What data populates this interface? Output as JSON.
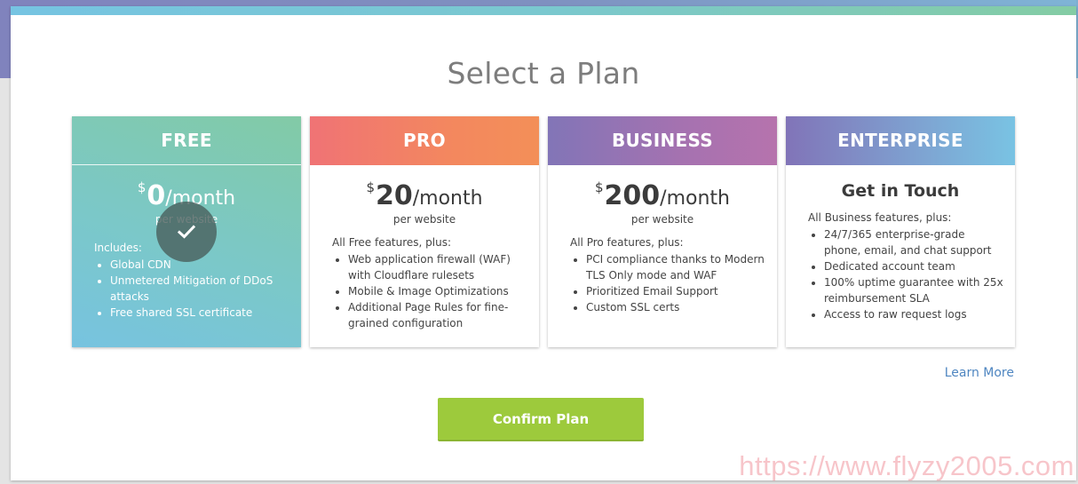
{
  "page": {
    "title": "Select a Plan",
    "learn_more": "Learn More",
    "confirm_label": "Confirm Plan",
    "watermark": "https://www.flyzy2005.com",
    "selected_plan": "FREE"
  },
  "colors": {
    "confirm": "#9dca3c",
    "link": "#4f86c1",
    "title": "#7d7d7d"
  },
  "plans": [
    {
      "name": "FREE",
      "currency": "$",
      "amount": "0",
      "period": "/month",
      "per": "per website",
      "intro": "Includes:",
      "features": [
        "Global CDN",
        "Unmetered Mitigation of DDoS attacks",
        "Free shared SSL certificate"
      ],
      "selected_icon": "check-icon"
    },
    {
      "name": "PRO",
      "currency": "$",
      "amount": "20",
      "period": "/month",
      "per": "per website",
      "intro": "All Free features, plus:",
      "features": [
        "Web application firewall (WAF) with Cloudflare rulesets",
        "Mobile & Image Optimizations",
        "Additional Page Rules for fine-grained configuration"
      ]
    },
    {
      "name": "BUSINESS",
      "currency": "$",
      "amount": "200",
      "period": "/month",
      "per": "per website",
      "intro": "All Pro features, plus:",
      "features": [
        "PCI compliance thanks to Modern TLS Only mode and WAF",
        "Prioritized Email Support",
        "Custom SSL certs"
      ]
    },
    {
      "name": "ENTERPRISE",
      "headline": "Get in Touch",
      "intro": "All Business features, plus:",
      "features": [
        "24/7/365 enterprise-grade phone, email, and chat support",
        "Dedicated account team",
        "100% uptime guarantee with 25x reimbursement SLA",
        "Access to raw request logs"
      ]
    }
  ]
}
